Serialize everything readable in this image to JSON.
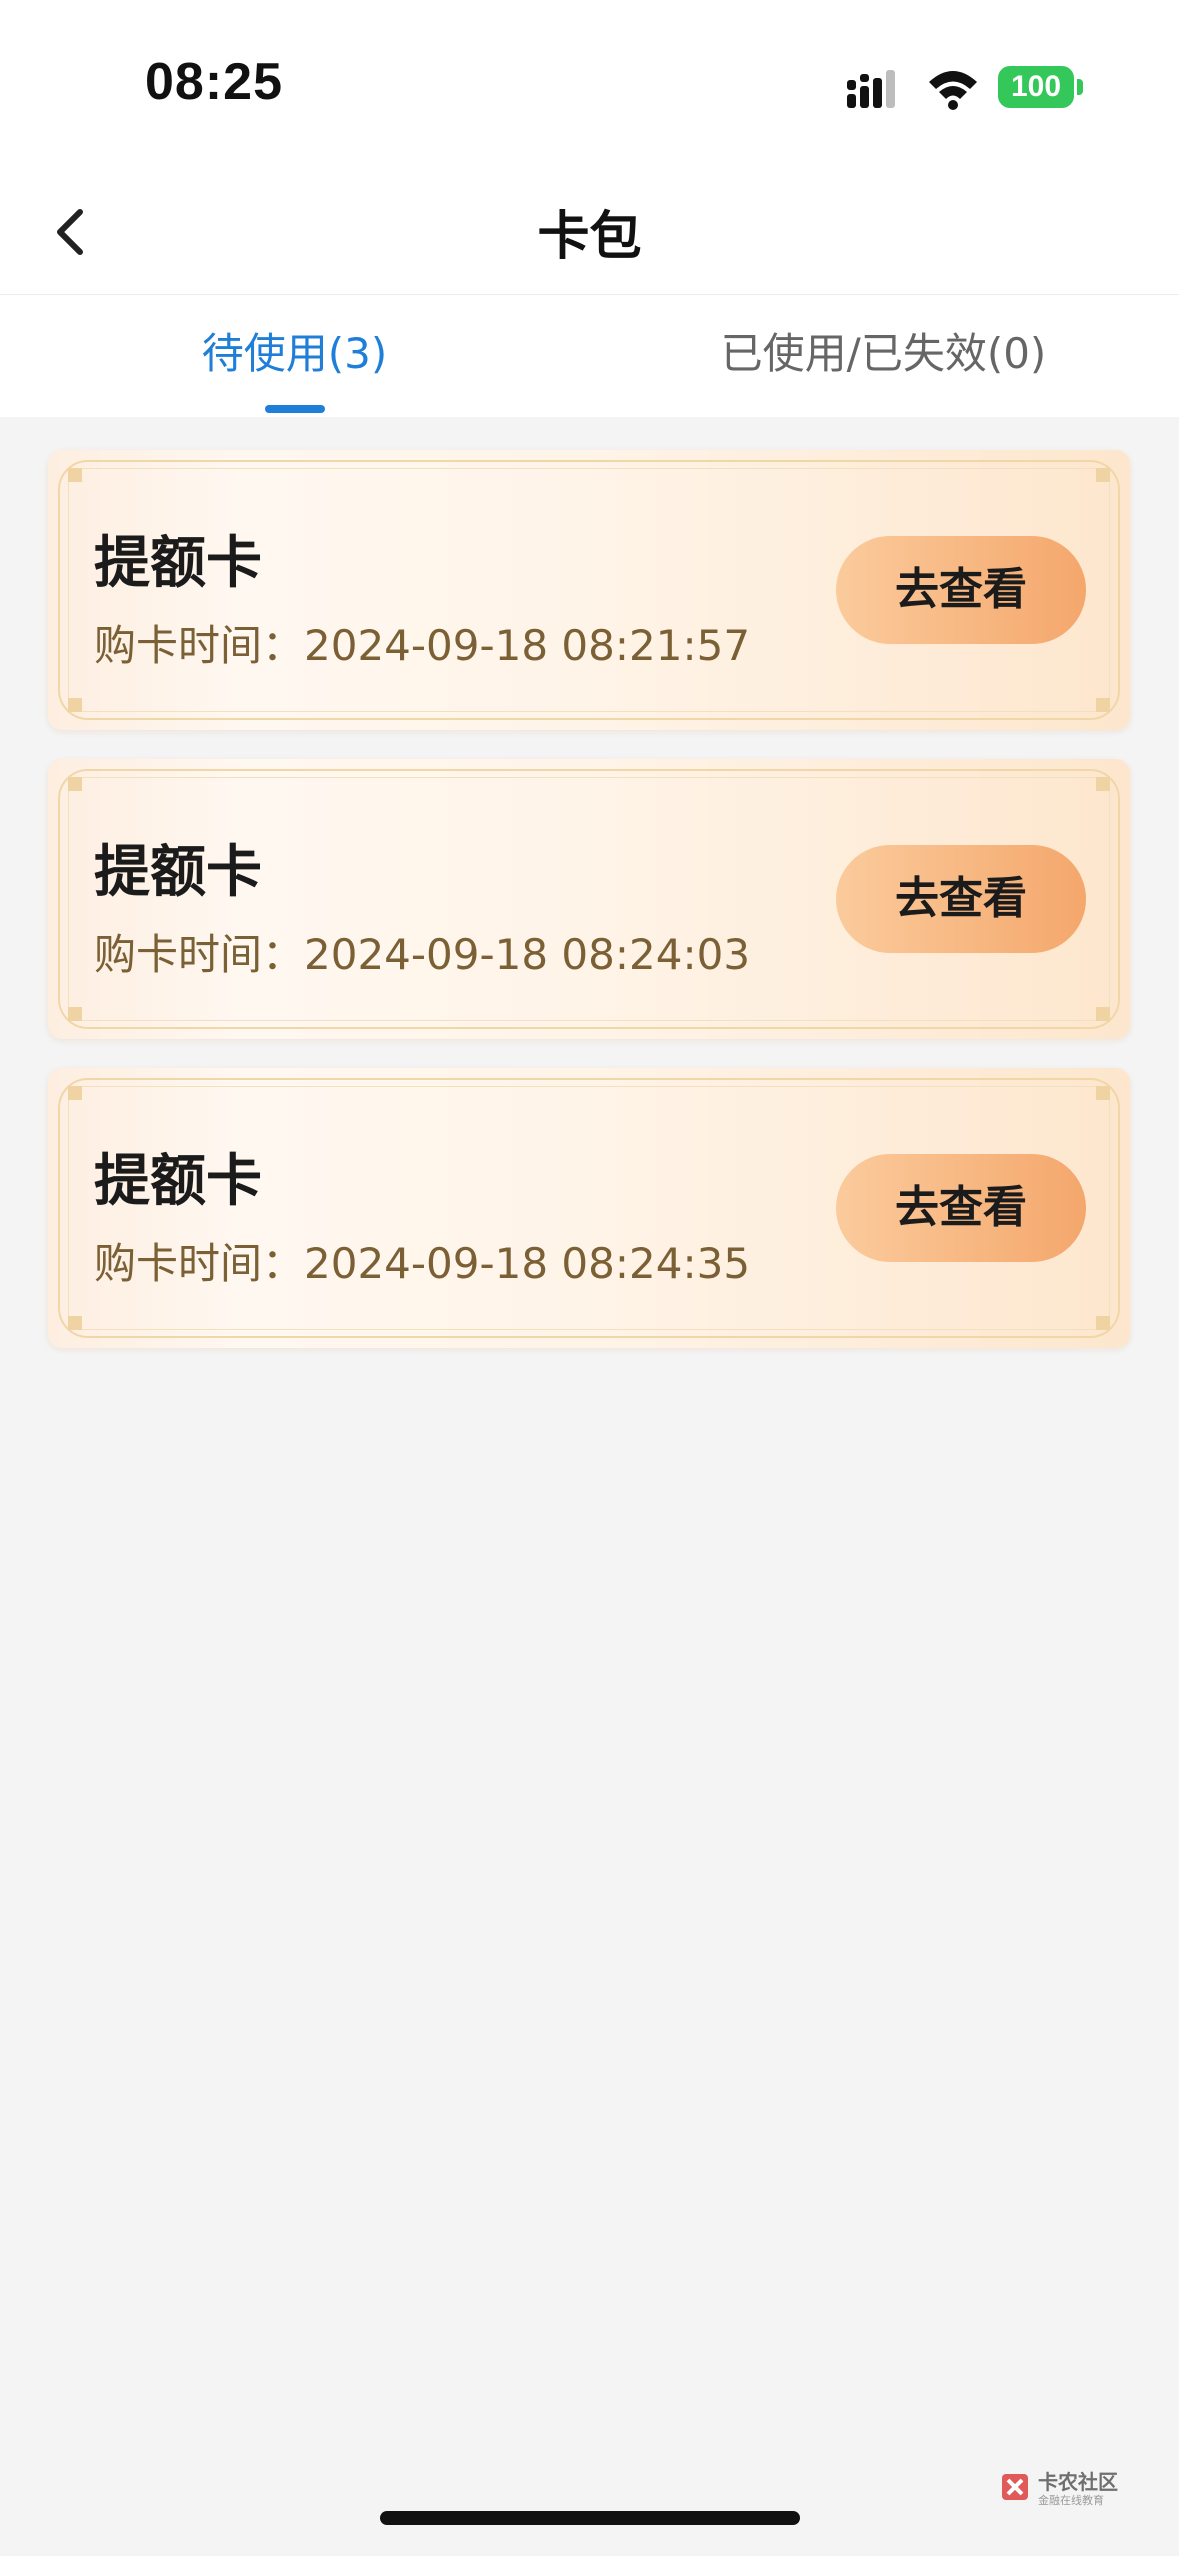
{
  "status_bar": {
    "time": "08:25",
    "battery": "100"
  },
  "nav": {
    "title": "卡包",
    "back_icon": "chevron-left-icon"
  },
  "tabs": [
    {
      "label": "待使用(3)",
      "active": true
    },
    {
      "label": "已使用/已失效(0)",
      "active": false
    }
  ],
  "cards": [
    {
      "title": "提额卡",
      "time_label": "购卡时间：2024-09-18 08:21:57",
      "button": "去查看"
    },
    {
      "title": "提额卡",
      "time_label": "购卡时间：2024-09-18 08:24:03",
      "button": "去查看"
    },
    {
      "title": "提额卡",
      "time_label": "购卡时间：2024-09-18 08:24:35",
      "button": "去查看"
    }
  ],
  "watermark": {
    "name": "卡农社区",
    "sub": "金融在线教育"
  },
  "colors": {
    "accent": "#1f7fd8",
    "button_start": "#fbcb9c",
    "button_end": "#f4a76c",
    "time_text": "#7b6035"
  }
}
